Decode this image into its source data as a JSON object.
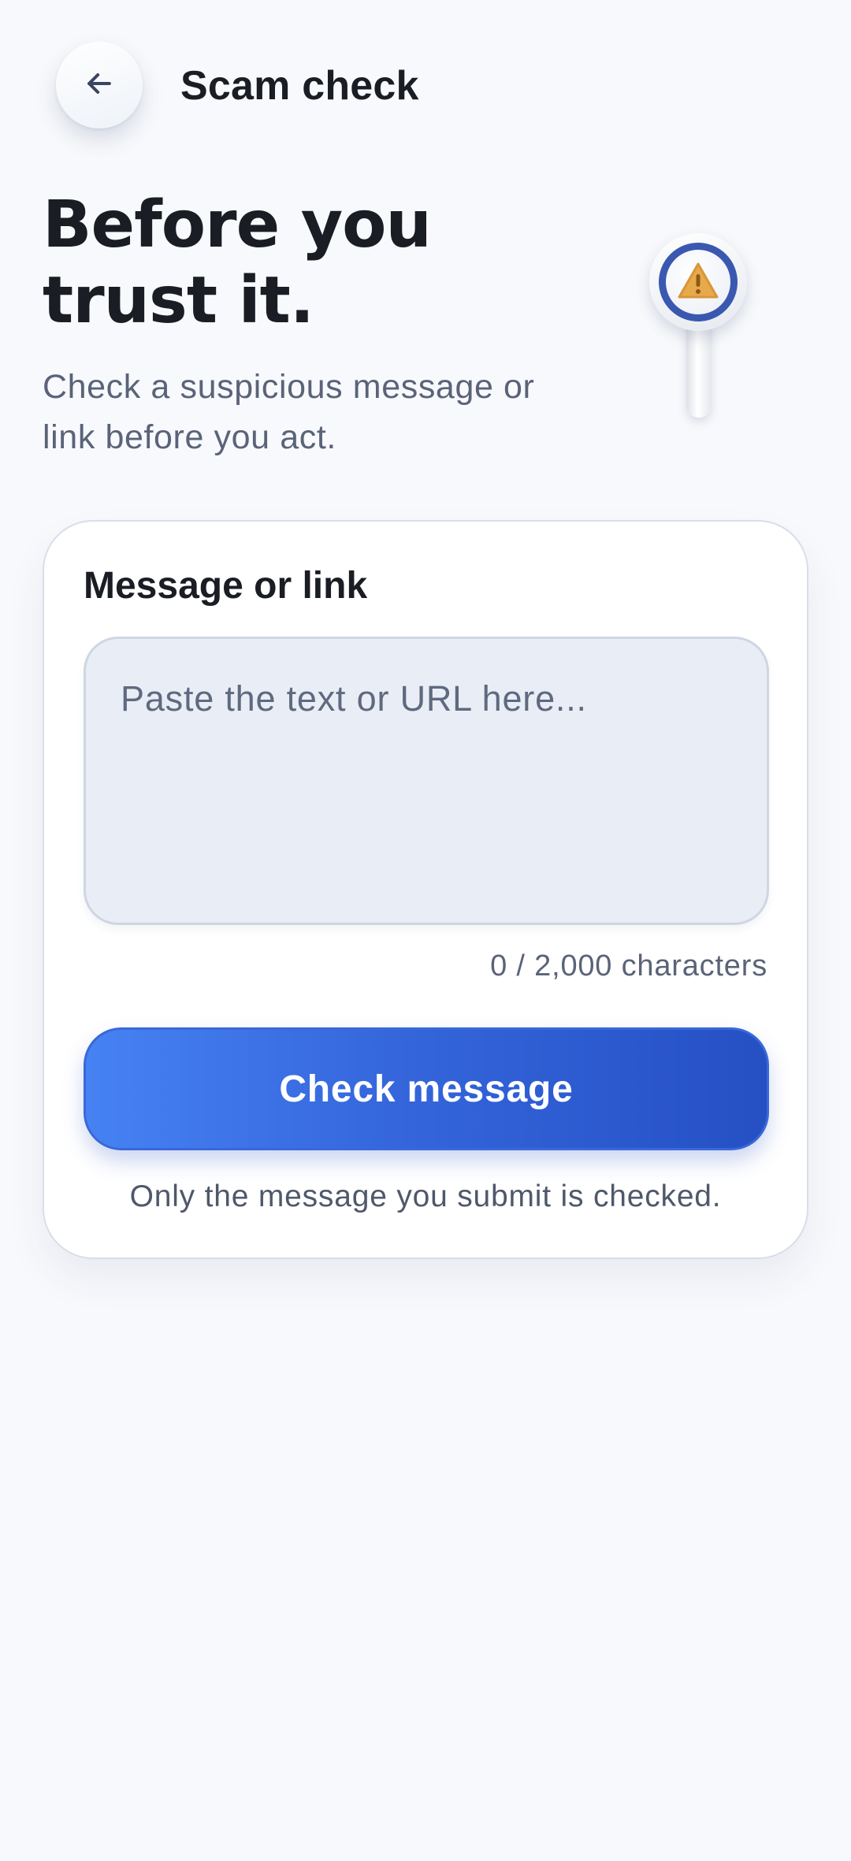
{
  "header": {
    "title": "Scam check",
    "back_icon": "arrow-left-icon"
  },
  "hero": {
    "heading_line1": "Before you",
    "heading_line2": "trust it.",
    "subtitle_line1": "Check a suspicious message or",
    "subtitle_line2": "link before you act.",
    "illustration_icon": "magnifier-warning-icon"
  },
  "form": {
    "label": "Message or link",
    "input_value": "",
    "input_placeholder": "Paste the text or URL here...",
    "char_count": "0 / 2,000 characters",
    "submit_label": "Check message",
    "privacy_note": "Only the message you submit is checked."
  },
  "colors": {
    "accent": "#3566dc",
    "warning": "#e8a94a",
    "background": "#f8f9fc"
  }
}
